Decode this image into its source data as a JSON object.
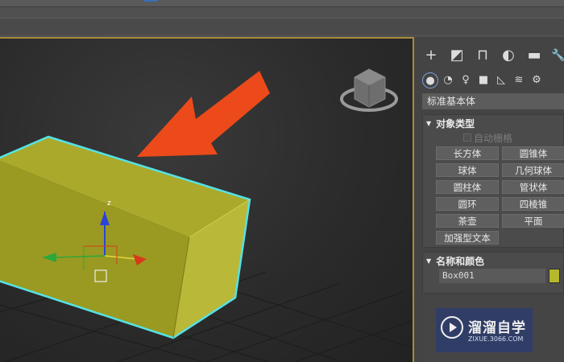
{
  "command_panel": {
    "tabs": [
      {
        "icon": "plus-icon",
        "glyph": "+"
      },
      {
        "icon": "modify-icon",
        "glyph": "◩"
      },
      {
        "icon": "hierarchy-icon",
        "glyph": "⊓"
      },
      {
        "icon": "motion-icon",
        "glyph": "◐"
      },
      {
        "icon": "display-icon",
        "glyph": "▬"
      },
      {
        "icon": "utilities-icon",
        "glyph": "🔧"
      }
    ],
    "subtabs": [
      {
        "icon": "geometry-icon",
        "glyph": "●"
      },
      {
        "icon": "shapes-icon",
        "glyph": "◔"
      },
      {
        "icon": "lights-icon",
        "glyph": "♀"
      },
      {
        "icon": "cameras-icon",
        "glyph": "■"
      },
      {
        "icon": "helpers-icon",
        "glyph": "◺"
      },
      {
        "icon": "spacewarps-icon",
        "glyph": "≋"
      },
      {
        "icon": "systems-icon",
        "glyph": "⚙"
      }
    ],
    "category_dropdown": "标准基本体",
    "object_type": {
      "title": "对象类型",
      "autogrid_label": "自动栅格",
      "buttons": [
        "长方体",
        "圆锥体",
        "球体",
        "几何球体",
        "圆柱体",
        "管状体",
        "圆环",
        "四棱锥",
        "茶壶",
        "平面",
        "加强型文本"
      ]
    },
    "name_and_color": {
      "title": "名称和颜色",
      "name_value": "Box001",
      "color": "#b5b82a"
    }
  },
  "viewport": {
    "gizmo_axes": [
      "z"
    ],
    "arrow_color": "#ec4a1a",
    "box_color": "#a6a52a",
    "selection_color": "#55e2e6"
  },
  "watermark": {
    "title": "溜溜自学",
    "url": "ZIXUE.3066.COM"
  }
}
